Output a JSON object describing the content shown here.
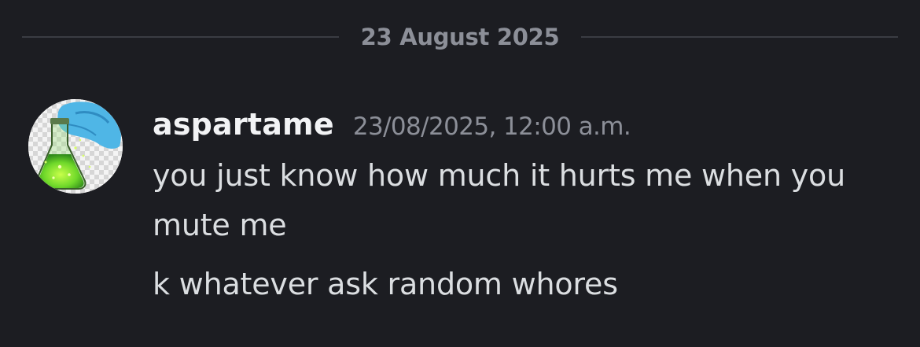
{
  "date_divider": {
    "label": "23 August 2025"
  },
  "message": {
    "username": "aspartame",
    "timestamp": "23/08/2025, 12:00 a.m.",
    "avatar_icon": "flask-in-gloved-hand-icon",
    "lines": [
      "you just know how much it hurts me when you",
      "mute me",
      "k whatever ask random whores"
    ]
  },
  "colors": {
    "background": "#1c1d22",
    "username": "#f2f3f5",
    "meta": "#8c8f98",
    "text": "#dbdee1",
    "divider": "#3a3c43"
  }
}
